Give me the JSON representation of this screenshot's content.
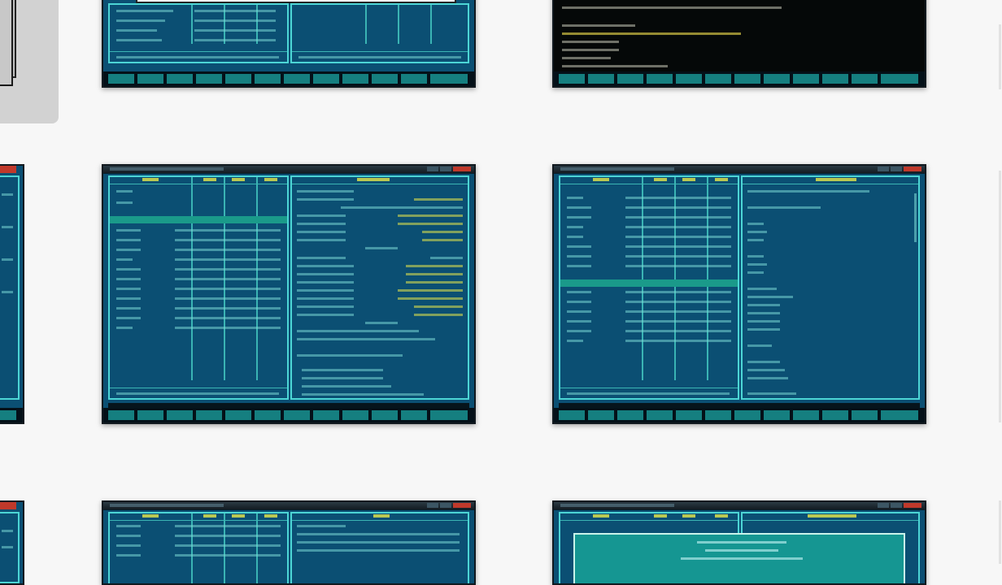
{
  "gallery": {
    "title": "",
    "description": "",
    "thumbnails": [
      {
        "name": "thumb-top-left-partial"
      },
      {
        "name": "thumb-top-center"
      },
      {
        "name": "thumb-top-right-editor"
      },
      {
        "name": "thumb-middle-left-partial"
      },
      {
        "name": "thumb-middle-center"
      },
      {
        "name": "thumb-middle-right"
      },
      {
        "name": "thumb-bottom-left-partial"
      },
      {
        "name": "thumb-bottom-center"
      },
      {
        "name": "thumb-bottom-right-dialog"
      }
    ]
  },
  "colors": {
    "background": "#f7f7f7",
    "panel_bg": "#0b4f73",
    "panel_border": "#4cd5d5",
    "fkey": "#157f80",
    "selection": "#1a9a8a",
    "dialog": "#159692",
    "titlebar_close": "#c0392b"
  }
}
